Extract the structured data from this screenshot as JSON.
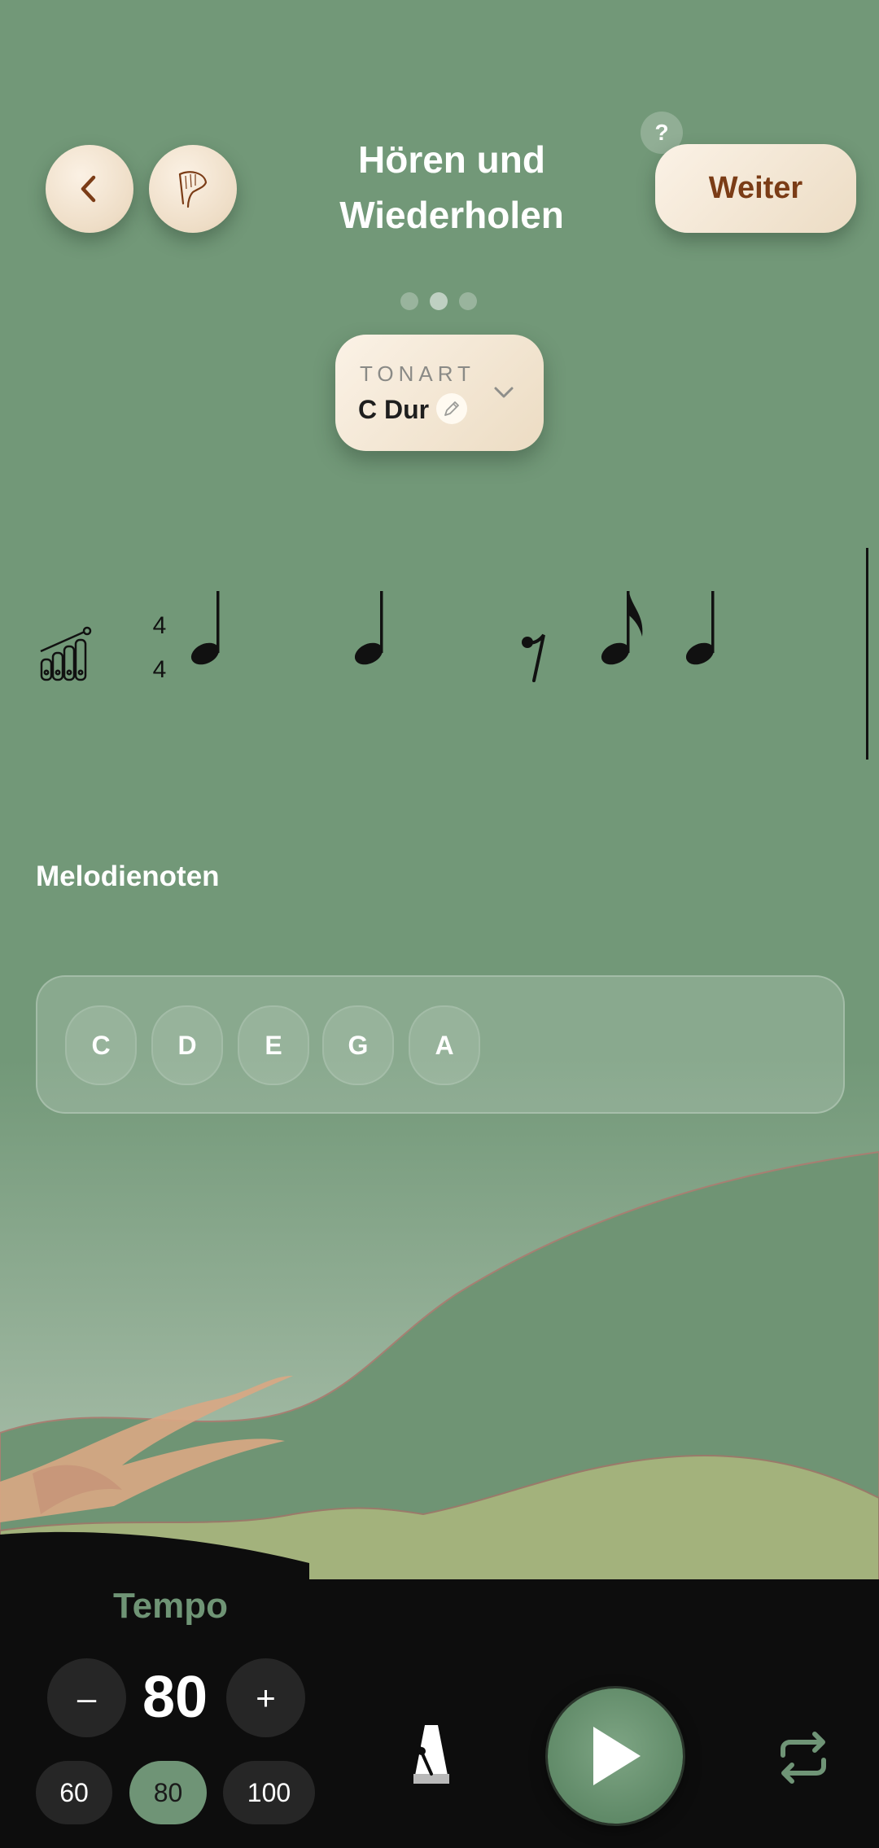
{
  "header": {
    "back_icon": "chevron-left-icon",
    "instrument_icon": "harp-icon",
    "title_line1": "Hören und",
    "title_line2": "Wiederholen",
    "help_label": "?",
    "next_label": "Weiter"
  },
  "pager": {
    "count": 3,
    "active_index": 1
  },
  "key_selector": {
    "label": "TONART",
    "value": "C Dur",
    "edit_icon": "pencil-icon",
    "dropdown_icon": "chevron-down-icon"
  },
  "staff": {
    "instrument_icon": "xylophone-icon",
    "time_signature": {
      "top": "4",
      "bottom": "4"
    },
    "notes": [
      "quarter",
      "quarter",
      "eighth-rest",
      "eighth",
      "quarter"
    ]
  },
  "melody_notes": {
    "title": "Melodienoten",
    "items": [
      "C",
      "D",
      "E",
      "G",
      "A"
    ]
  },
  "tempo": {
    "title": "Tempo",
    "minus_label": "–",
    "plus_label": "+",
    "value": "80",
    "presets": [
      "60",
      "80",
      "100"
    ],
    "active_preset": "80"
  },
  "controls": {
    "metronome_icon": "metronome-icon",
    "play_icon": "play-icon",
    "loop_icon": "repeat-icon"
  },
  "colors": {
    "background": "#729878",
    "accent": "#6f9476",
    "cream": "#f6e9d8",
    "brown_text": "#7b3c16",
    "bottom_bar": "#0d0d0d"
  }
}
